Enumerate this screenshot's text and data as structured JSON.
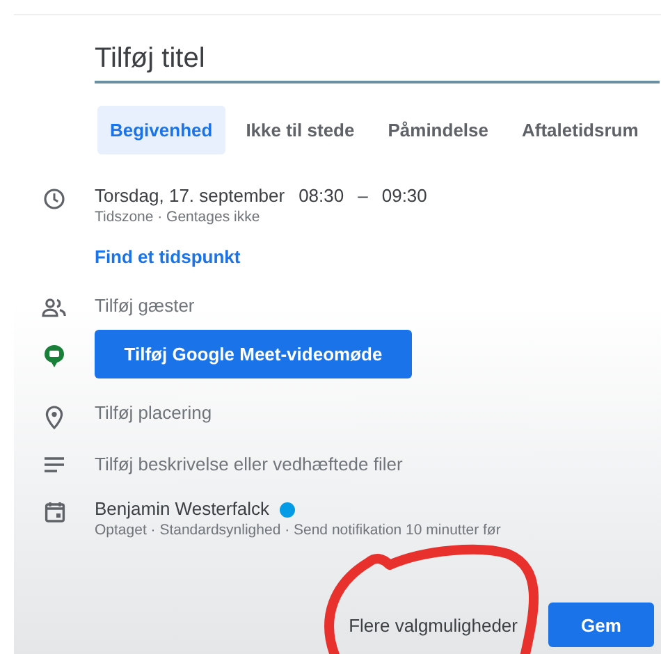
{
  "title_field": {
    "placeholder": "Tilføj titel"
  },
  "tabs": [
    {
      "label": "Begivenhed",
      "selected": true
    },
    {
      "label": "Ikke til stede",
      "selected": false
    },
    {
      "label": "Påmindelse",
      "selected": false
    },
    {
      "label": "Aftaletidsrum",
      "selected": false
    }
  ],
  "rows": [
    {
      "kind": "time",
      "date": "Torsdag, 17. september",
      "start": "08:30",
      "dash": "–",
      "end": "09:30",
      "sub": "Tidszone · Gentages ikke"
    },
    {
      "kind": "link",
      "label": "Find et tidspunkt"
    },
    {
      "kind": "text",
      "label": "Tilføj gæster"
    },
    {
      "kind": "button",
      "label": "Tilføj Google Meet-videomøde"
    },
    {
      "kind": "text",
      "label": "Tilføj placering"
    },
    {
      "kind": "text",
      "label": "Tilføj beskrivelse eller vedhæftede filer"
    },
    {
      "kind": "calendar",
      "label": "Benjamin Westerfalck",
      "color": "#039be5",
      "sub": "Optaget · Standardsynlighed · Send notifikation 10 minutter før"
    }
  ],
  "footer": {
    "more": "Flere valgmuligheder",
    "save": "Gem"
  }
}
